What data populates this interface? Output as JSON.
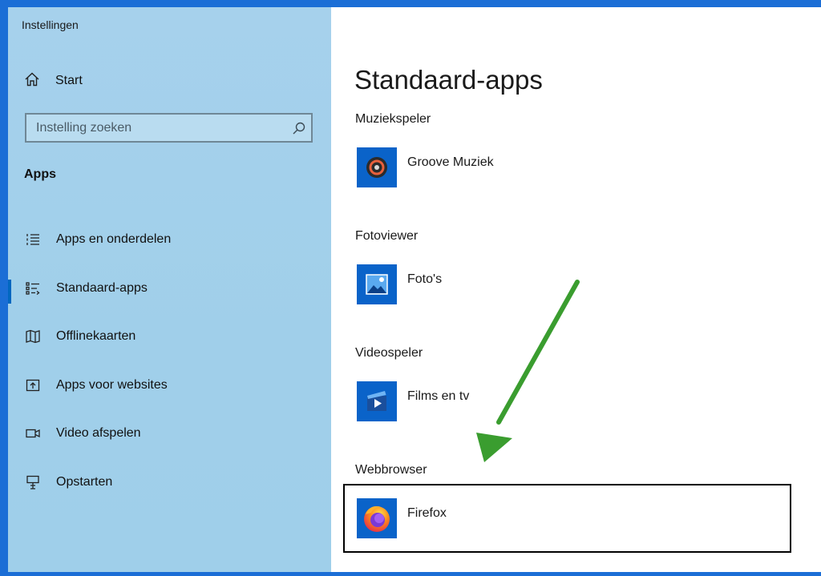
{
  "window": {
    "title": "Instellingen"
  },
  "sidebar": {
    "home_label": "Start",
    "search": {
      "placeholder": "Instelling zoeken",
      "value": ""
    },
    "section_title": "Apps",
    "items": [
      {
        "label": "Apps en onderdelen",
        "icon": "list-icon",
        "selected": false
      },
      {
        "label": "Standaard-apps",
        "icon": "default-apps-icon",
        "selected": true
      },
      {
        "label": "Offlinekaarten",
        "icon": "map-icon",
        "selected": false
      },
      {
        "label": "Apps voor websites",
        "icon": "web-apps-icon",
        "selected": false
      },
      {
        "label": "Video afspelen",
        "icon": "video-icon",
        "selected": false
      },
      {
        "label": "Opstarten",
        "icon": "startup-icon",
        "selected": false
      }
    ]
  },
  "main": {
    "page_title": "Standaard-apps",
    "categories": [
      {
        "label": "Muziekspeler",
        "app": "Groove Muziek",
        "icon": "groove-music-icon"
      },
      {
        "label": "Fotoviewer",
        "app": "Foto's",
        "icon": "photos-icon"
      },
      {
        "label": "Videospeler",
        "app": "Films en tv",
        "icon": "films-tv-icon"
      },
      {
        "label": "Webbrowser",
        "app": "Firefox",
        "icon": "firefox-icon"
      }
    ]
  },
  "colors": {
    "accent": "#0067c0",
    "arrow": "#3a9d2f",
    "tile": "#0a63c9",
    "sidebar": "#a2d0eb"
  }
}
